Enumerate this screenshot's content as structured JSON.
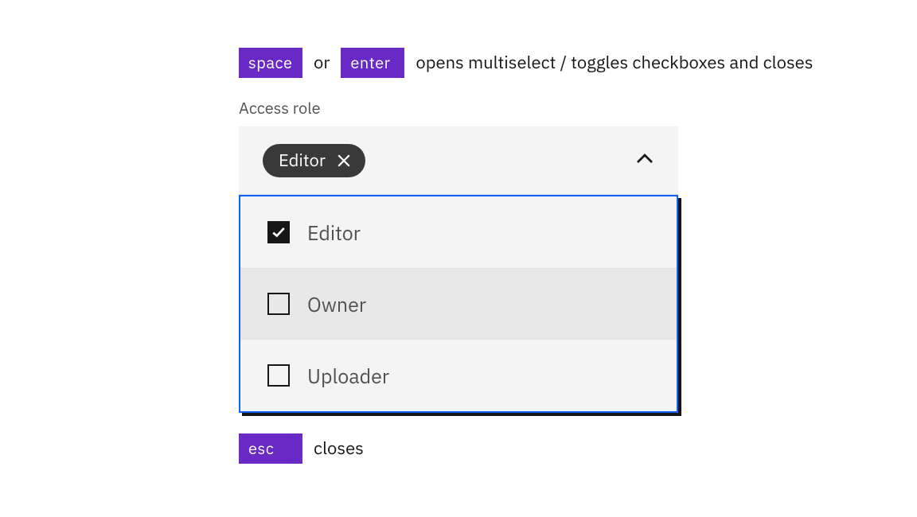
{
  "hints": {
    "top": {
      "key1": "space",
      "connector": "or",
      "key2": "enter",
      "desc": "opens multiselect / toggles checkboxes and closes"
    },
    "bottom": {
      "key": "esc",
      "desc": "closes"
    }
  },
  "field": {
    "label": "Access role",
    "selected_chip": "Editor"
  },
  "options": [
    {
      "label": "Editor",
      "checked": true,
      "highlight": false
    },
    {
      "label": "Owner",
      "checked": false,
      "highlight": true
    },
    {
      "label": "Uploader",
      "checked": false,
      "highlight": false
    }
  ]
}
